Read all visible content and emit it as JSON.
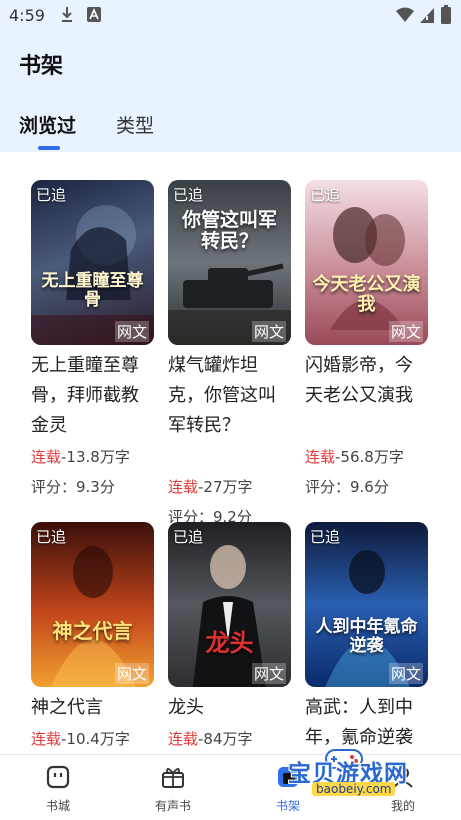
{
  "status": {
    "time": "4:59"
  },
  "header": {
    "title": "书架",
    "tabs": [
      "浏览过",
      "类型"
    ]
  },
  "books": [
    {
      "cover_title": "无上重瞳至尊骨",
      "tag": "已追",
      "watermark": "网文",
      "name": "无上重瞳至尊骨，拜师截教金灵",
      "status": "连载",
      "words": "-13.8万字",
      "rating": "评分：9.3分",
      "colors": [
        "#1c2440",
        "#4a5a7a",
        "#2a1e2c"
      ]
    },
    {
      "cover_title": "你管这叫军转民？",
      "tag": "已追",
      "watermark": "网文",
      "name": "煤气罐炸坦克，你管这叫军转民？",
      "status": "连载",
      "words": "-27万字",
      "rating": "评分：9.2分",
      "colors": [
        "#3a3f45",
        "#6d747a",
        "#2b2e31"
      ]
    },
    {
      "cover_title": "今天老公又演我",
      "tag": "已追",
      "watermark": "网文",
      "name": "闪婚影帝，今天老公又演我",
      "status": "连载",
      "words": "-56.8万字",
      "rating": "评分：9.6分",
      "colors": [
        "#f4dfe3",
        "#c98c97",
        "#9a4a58"
      ]
    },
    {
      "cover_title": "神之代言",
      "tag": "已追",
      "watermark": "网文",
      "name": "神之代言",
      "status": "连载",
      "words": "-10.4万字",
      "rating": "",
      "colors": [
        "#3a0f0a",
        "#c2461c",
        "#f2a030"
      ]
    },
    {
      "cover_title": "龙头",
      "tag": "已追",
      "watermark": "网文",
      "name": "龙头",
      "status": "连载",
      "words": "-84万字",
      "rating": "",
      "colors": [
        "#1e1f22",
        "#55585e",
        "#2c2d30"
      ]
    },
    {
      "cover_title": "人到中年氪命逆袭",
      "tag": "已追",
      "watermark": "网文",
      "name": "高武：人到中年，氪命逆袭",
      "status": "",
      "words": "",
      "rating": "",
      "colors": [
        "#0d1a3a",
        "#2a5fb0",
        "#0a2a6a"
      ]
    }
  ],
  "nav": [
    {
      "label": "书城",
      "icon": "bookstore-icon"
    },
    {
      "label": "有声书",
      "icon": "gift-box-icon"
    },
    {
      "label": "书架",
      "icon": "bookshelf-icon"
    },
    {
      "label": "我的",
      "icon": "person-icon"
    }
  ],
  "watermark": {
    "line1": "宝贝游戏网",
    "line2": "baobeiy.com"
  },
  "accent": "#2f6ee8",
  "serial_color": "#e23a3a"
}
